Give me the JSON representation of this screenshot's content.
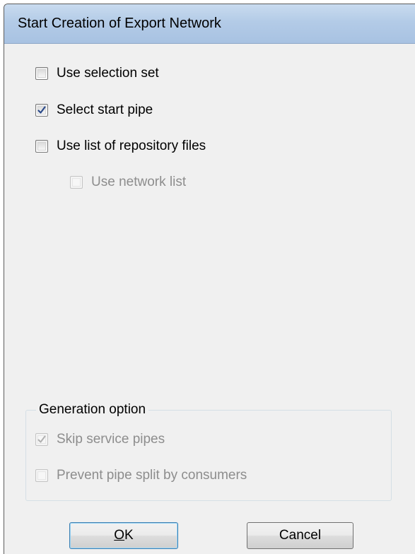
{
  "window": {
    "title": "Start Creation of Export Network"
  },
  "options": {
    "use_selection_set": {
      "label": "Use selection set",
      "checked": false,
      "enabled": true
    },
    "select_start_pipe": {
      "label": "Select start pipe",
      "checked": true,
      "enabled": true
    },
    "use_list_repository": {
      "label": "Use list of repository files",
      "checked": false,
      "enabled": true
    },
    "use_network_list": {
      "label": "Use network list",
      "checked": false,
      "enabled": false
    }
  },
  "generation": {
    "title": "Generation option",
    "skip_service_pipes": {
      "label": "Skip service pipes",
      "checked": true,
      "enabled": false
    },
    "prevent_pipe_split": {
      "label": "Prevent pipe split by consumers",
      "checked": false,
      "enabled": false
    }
  },
  "buttons": {
    "ok_mnemonic": "O",
    "ok_rest": "K",
    "cancel": "Cancel"
  }
}
